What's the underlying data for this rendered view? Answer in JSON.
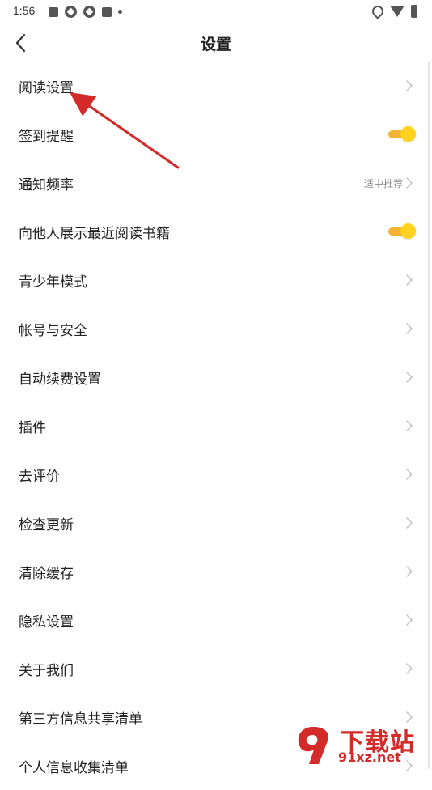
{
  "status_bar": {
    "time": "1:56",
    "icons": [
      "square-icon",
      "photo-icon",
      "photo-icon",
      "square-icon",
      "dot-icon",
      "location-icon",
      "wifi-icon",
      "battery-icon"
    ]
  },
  "header": {
    "title": "设置",
    "back_icon": "chevron-left-icon"
  },
  "colors": {
    "toggle_track": "#f5b335",
    "toggle_knob": "#ffd21f",
    "arrow": "#d42a2a",
    "watermark": "#d42a2a"
  },
  "settings": {
    "items": [
      {
        "label": "阅读设置",
        "control": "chevron"
      },
      {
        "label": "签到提醒",
        "control": "toggle",
        "on": true
      },
      {
        "label": "通知频率",
        "control": "chevron",
        "value": "适中推荐"
      },
      {
        "label": "向他人展示最近阅读书籍",
        "control": "toggle",
        "on": true
      },
      {
        "label": "青少年模式",
        "control": "chevron"
      },
      {
        "label": "帐号与安全",
        "control": "chevron"
      },
      {
        "label": "自动续费设置",
        "control": "chevron"
      },
      {
        "label": "插件",
        "control": "chevron"
      },
      {
        "label": "去评价",
        "control": "chevron"
      },
      {
        "label": "检查更新",
        "control": "chevron"
      },
      {
        "label": "清除缓存",
        "control": "chevron"
      },
      {
        "label": "隐私设置",
        "control": "chevron"
      },
      {
        "label": "关于我们",
        "control": "chevron"
      },
      {
        "label": "第三方信息共享清单",
        "control": "chevron"
      },
      {
        "label": "个人信息收集清单",
        "control": "chevron"
      }
    ]
  },
  "watermark": {
    "title": "下载站",
    "url": "91xz.net"
  }
}
